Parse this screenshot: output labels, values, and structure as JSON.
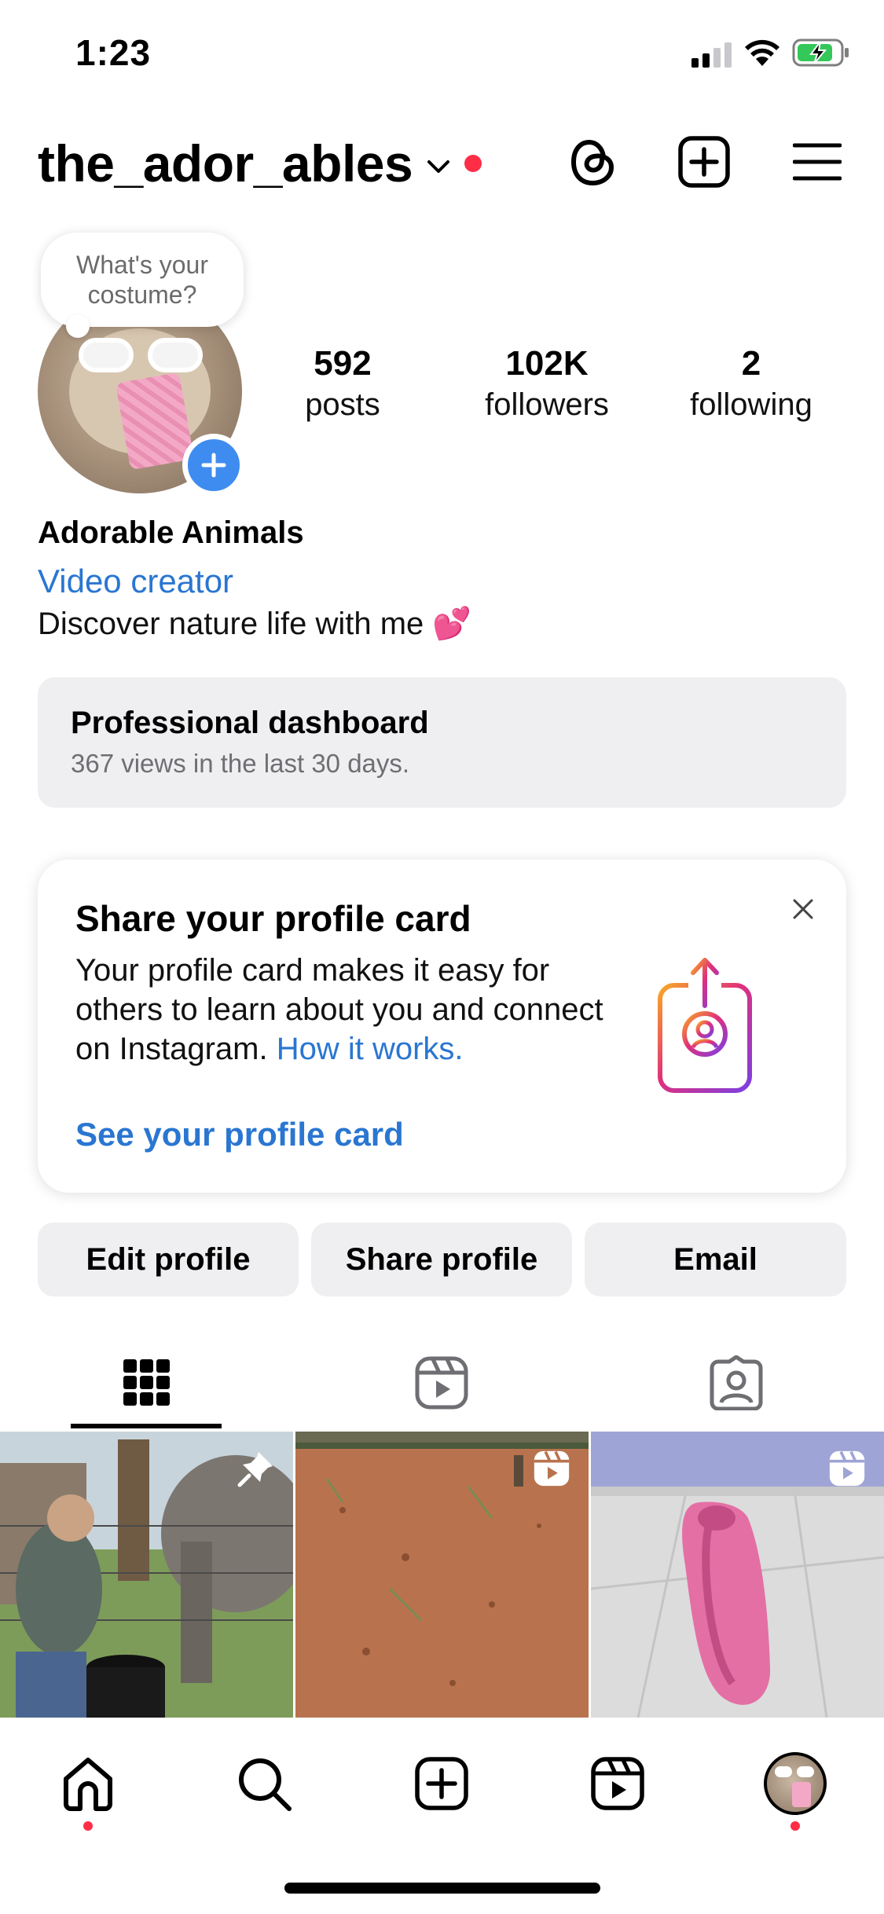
{
  "status_bar": {
    "time": "1:23",
    "signal_icon": "cellular-signal-icon",
    "wifi_icon": "wifi-icon",
    "battery_icon": "battery-charging-icon"
  },
  "header": {
    "username": "the_ador_ables",
    "threads_icon": "threads-icon",
    "create_icon": "plus-square-icon",
    "menu_icon": "hamburger-menu-icon"
  },
  "profile": {
    "note": "What's your costume?",
    "stats": [
      {
        "value": "592",
        "label": "posts"
      },
      {
        "value": "102K",
        "label": "followers"
      },
      {
        "value": "2",
        "label": "following"
      }
    ],
    "display_name": "Adorable Animals",
    "category": "Video creator",
    "bio": "Discover nature life with me 💕"
  },
  "dashboard": {
    "title": "Professional dashboard",
    "subtitle": "367 views in the last 30 days."
  },
  "profile_card": {
    "title": "Share your profile card",
    "description": "Your profile card makes it easy for others to learn about you and connect on Instagram.",
    "how_link": "How it works.",
    "cta": "See your profile card"
  },
  "actions": {
    "edit": "Edit profile",
    "share": "Share profile",
    "email": "Email"
  },
  "tabs": [
    {
      "icon": "grid-icon",
      "active": true
    },
    {
      "icon": "reels-icon",
      "active": false
    },
    {
      "icon": "tagged-icon",
      "active": false
    }
  ],
  "posts": [
    {
      "badge": "pin-icon"
    },
    {
      "badge": "reels-icon"
    },
    {
      "badge": "reels-icon"
    }
  ],
  "bottom_nav": [
    {
      "icon": "home-icon",
      "notification": true
    },
    {
      "icon": "search-icon",
      "notification": false
    },
    {
      "icon": "create-icon",
      "notification": false
    },
    {
      "icon": "reels-icon",
      "notification": false
    },
    {
      "icon": "profile-avatar",
      "notification": true
    }
  ],
  "colors": {
    "accent_blue": "#2a76d1",
    "notification_red": "#ff2d46",
    "button_gray": "#efeff1"
  }
}
